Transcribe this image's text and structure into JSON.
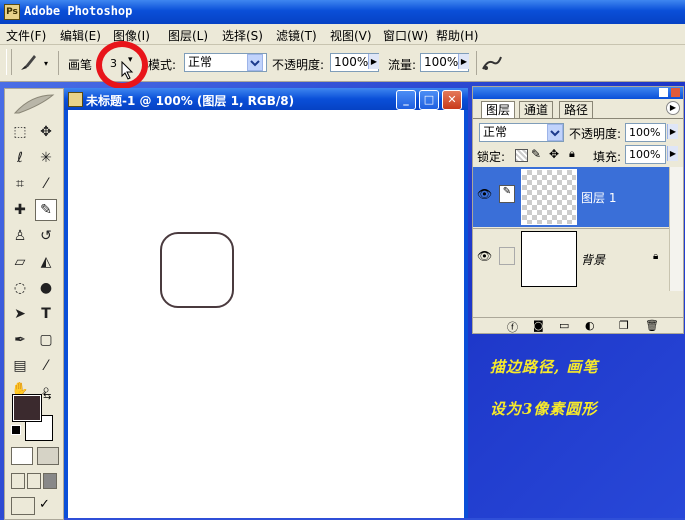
{
  "app": {
    "title": "Adobe Photoshop"
  },
  "menu": [
    "文件(F)",
    "编辑(E)",
    "图像(I)",
    "图层(L)",
    "选择(S)",
    "滤镜(T)",
    "视图(V)",
    "窗口(W)",
    "帮助(H)"
  ],
  "options": {
    "brush_label": "画笔",
    "brush_size": "3",
    "mode_label": "模式:",
    "mode_value": "正常",
    "opacity_label": "不透明度:",
    "opacity_value": "100%",
    "flow_label": "流量:",
    "flow_value": "100%"
  },
  "document": {
    "title": "未标题-1 @ 100% (图层 1, RGB/8)"
  },
  "layers_panel": {
    "tabs": [
      "图层",
      "通道",
      "路径"
    ],
    "blend_mode": "正常",
    "opacity_label": "不透明度:",
    "opacity_value": "100%",
    "lock_label": "锁定:",
    "fill_label": "填充:",
    "fill_value": "100%",
    "layers": [
      {
        "name": "图层 1",
        "selected": true
      },
      {
        "name": "背景",
        "selected": false
      }
    ]
  },
  "instructions": {
    "line1": "描边路径, 画笔",
    "line2": "设为3像素圆形"
  },
  "colors": {
    "foreground": "#3b2a2e",
    "background": "#ffffff",
    "highlight_circle": "#e8141a",
    "instruction_text": "#f7ea2a",
    "selected_layer": "#3a6fd8"
  },
  "icons": {
    "brush_tool": "brush-icon",
    "cursor": "arrow-cursor-icon",
    "eye": "eye-icon",
    "lock": "lock-icon"
  }
}
